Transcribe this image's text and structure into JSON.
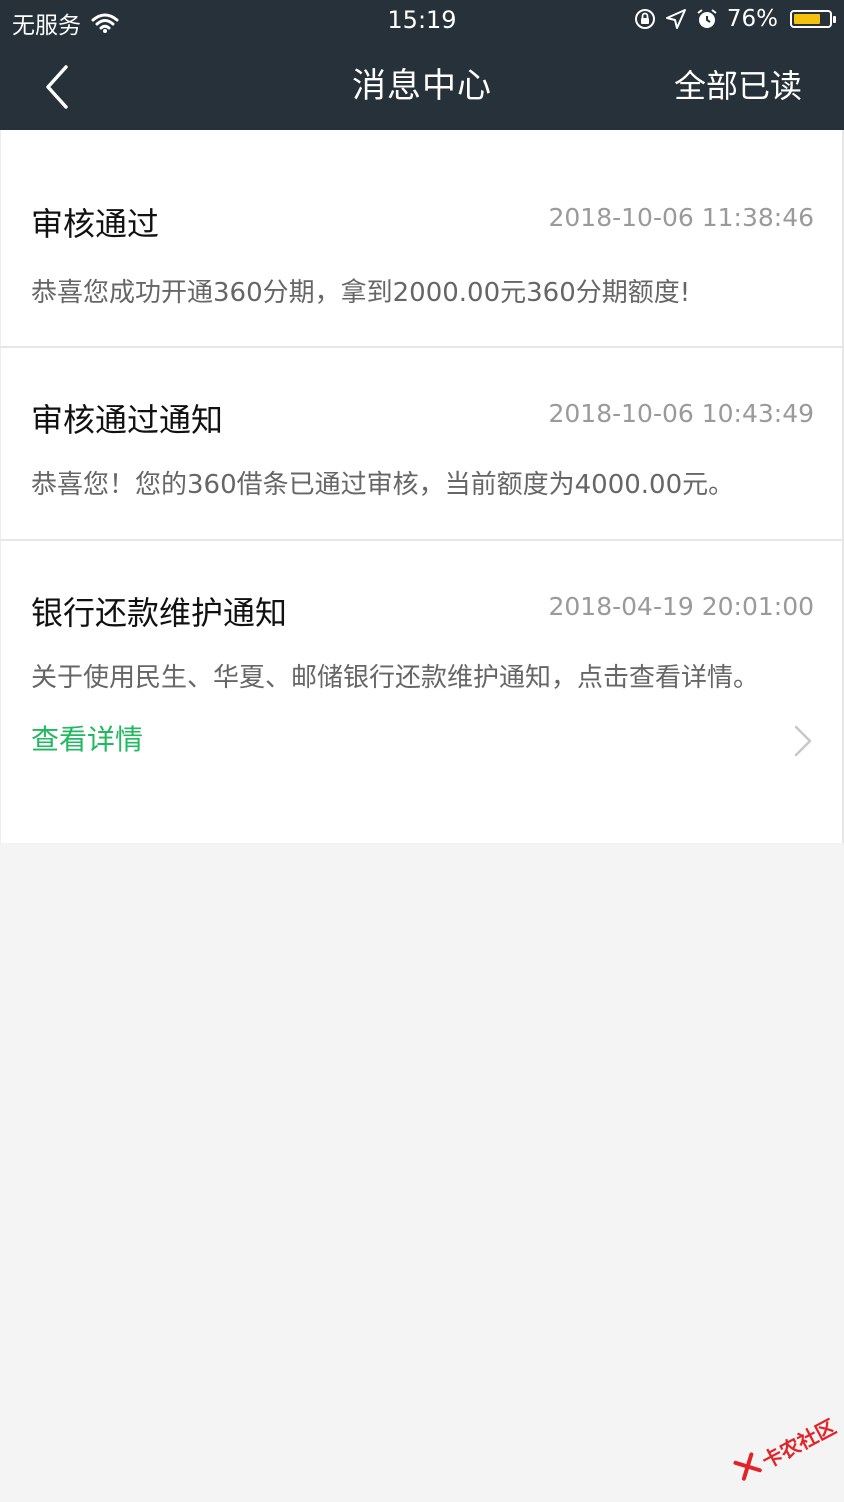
{
  "status_bar": {
    "carrier": "无服务",
    "time": "15:19",
    "battery": "76%",
    "battery_level": 0.76,
    "icons": [
      "wifi-icon",
      "orientation-lock-icon",
      "location-arrow-icon",
      "alarm-icon",
      "battery-icon"
    ]
  },
  "nav": {
    "title": "消息中心",
    "mark_all_read": "全部已读",
    "back_icon": "chevron-left-icon"
  },
  "messages": [
    {
      "title": "审核通过",
      "time": "2018-10-06 11:38:46",
      "body": "恭喜您成功开通360分期，拿到2000.00元360分期额度!"
    },
    {
      "title": "审核通过通知",
      "time": "2018-10-06 10:43:49",
      "body": "恭喜您！您的360借条已通过审核，当前额度为4000.00元。"
    },
    {
      "title": "银行还款维护通知",
      "time": "2018-04-19 20:01:00",
      "body": "关于使用民生、华夏、邮储银行还款维护通知，点击查看详情。",
      "detail_label": "查看详情"
    }
  ],
  "watermark": {
    "text": "卡农社区"
  },
  "colors": {
    "header_bg": "#27313a",
    "page_bg": "#f4f4f4",
    "card_bg": "#ffffff",
    "accent_green": "#21b95f",
    "time_gray": "#9a9a9a",
    "body_gray": "#666666",
    "battery_yellow": "#f4c20d"
  }
}
